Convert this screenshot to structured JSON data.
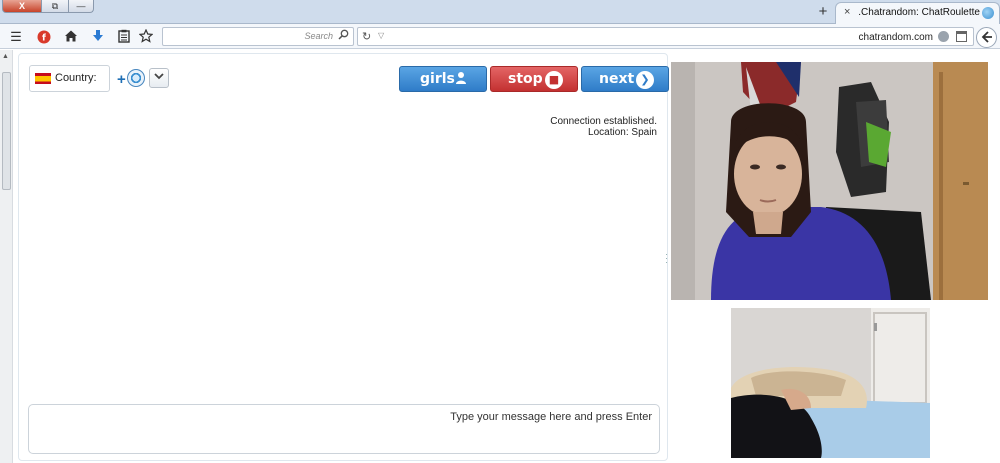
{
  "browser": {
    "tab_title": "Chatrandom: ChatRoulette...",
    "tab_close": "×",
    "new_tab": "+",
    "window_buttons": {
      "close": "X",
      "maximize": "⧉",
      "minimize": "—"
    },
    "url": "chatrandom.com",
    "search_placeholder": "Search",
    "reload_glyph": "↻",
    "url_dropdown_glyph": "▽",
    "icons": [
      "menu-icon",
      "flash-icon",
      "home-icon",
      "download-icon",
      "reading-list-icon",
      "bookmark-star-icon",
      "search-icon",
      "globe-icon",
      "calendar-icon",
      "back-arrow-icon"
    ]
  },
  "chat": {
    "country_label": "Country:",
    "country_flag": "spain-flag",
    "buttons": {
      "girls": "girls",
      "stop": "stop",
      "next": "next"
    },
    "status_lines": [
      "Connection established.",
      "Location: Spain"
    ],
    "message_placeholder": "Type your message here and press Enter",
    "resize_handle": "...",
    "colors": {
      "blue_button": "#2f7cc8",
      "red_button": "#c33131"
    }
  },
  "videos": {
    "remote": "remote-video",
    "self": "self-video"
  }
}
